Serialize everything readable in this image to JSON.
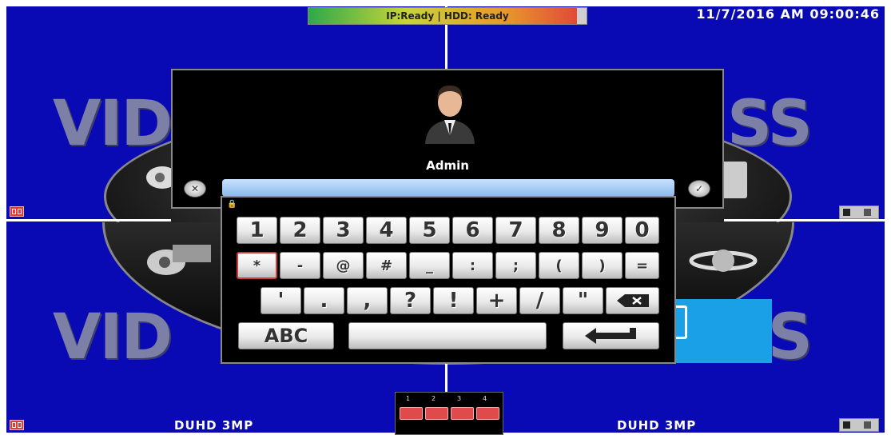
{
  "top_bar": {
    "status_text": "IP:Ready | HDD: Ready",
    "datetime": "11/7/2016 AM 09:00:46"
  },
  "quadrants": [
    {
      "watermark": "VID",
      "camera_label": ""
    },
    {
      "watermark": "SS",
      "camera_label": ""
    },
    {
      "watermark": "VID",
      "camera_label": "DUHD 3MP"
    },
    {
      "watermark": "SS",
      "camera_label": "DUHD 3MP"
    }
  ],
  "login": {
    "username": "Admin",
    "password_value": "",
    "cancel_icon": "cancel-icon",
    "confirm_icon": "checkmark-icon",
    "avatar_icon": "user-avatar-icon"
  },
  "keyboard": {
    "row1": [
      "1",
      "2",
      "3",
      "4",
      "5",
      "6",
      "7",
      "8",
      "9",
      "0"
    ],
    "row2": [
      "*",
      "-",
      "@",
      "#",
      "_",
      ":",
      ";",
      "(",
      ")",
      "="
    ],
    "row3": [
      "'",
      ".",
      ",",
      "?",
      "!",
      "+",
      "/",
      "\""
    ],
    "backspace_icon": "backspace-icon",
    "mode_label": "ABC",
    "space_label": "",
    "enter_icon": "enter-icon",
    "lock_icon": "lock-icon"
  },
  "channels": {
    "numbers": [
      "1",
      "2",
      "3",
      "4"
    ]
  },
  "colors": {
    "background": "#0a0ab4",
    "accent": "#e04a4a",
    "input": "#a9cdf5"
  }
}
